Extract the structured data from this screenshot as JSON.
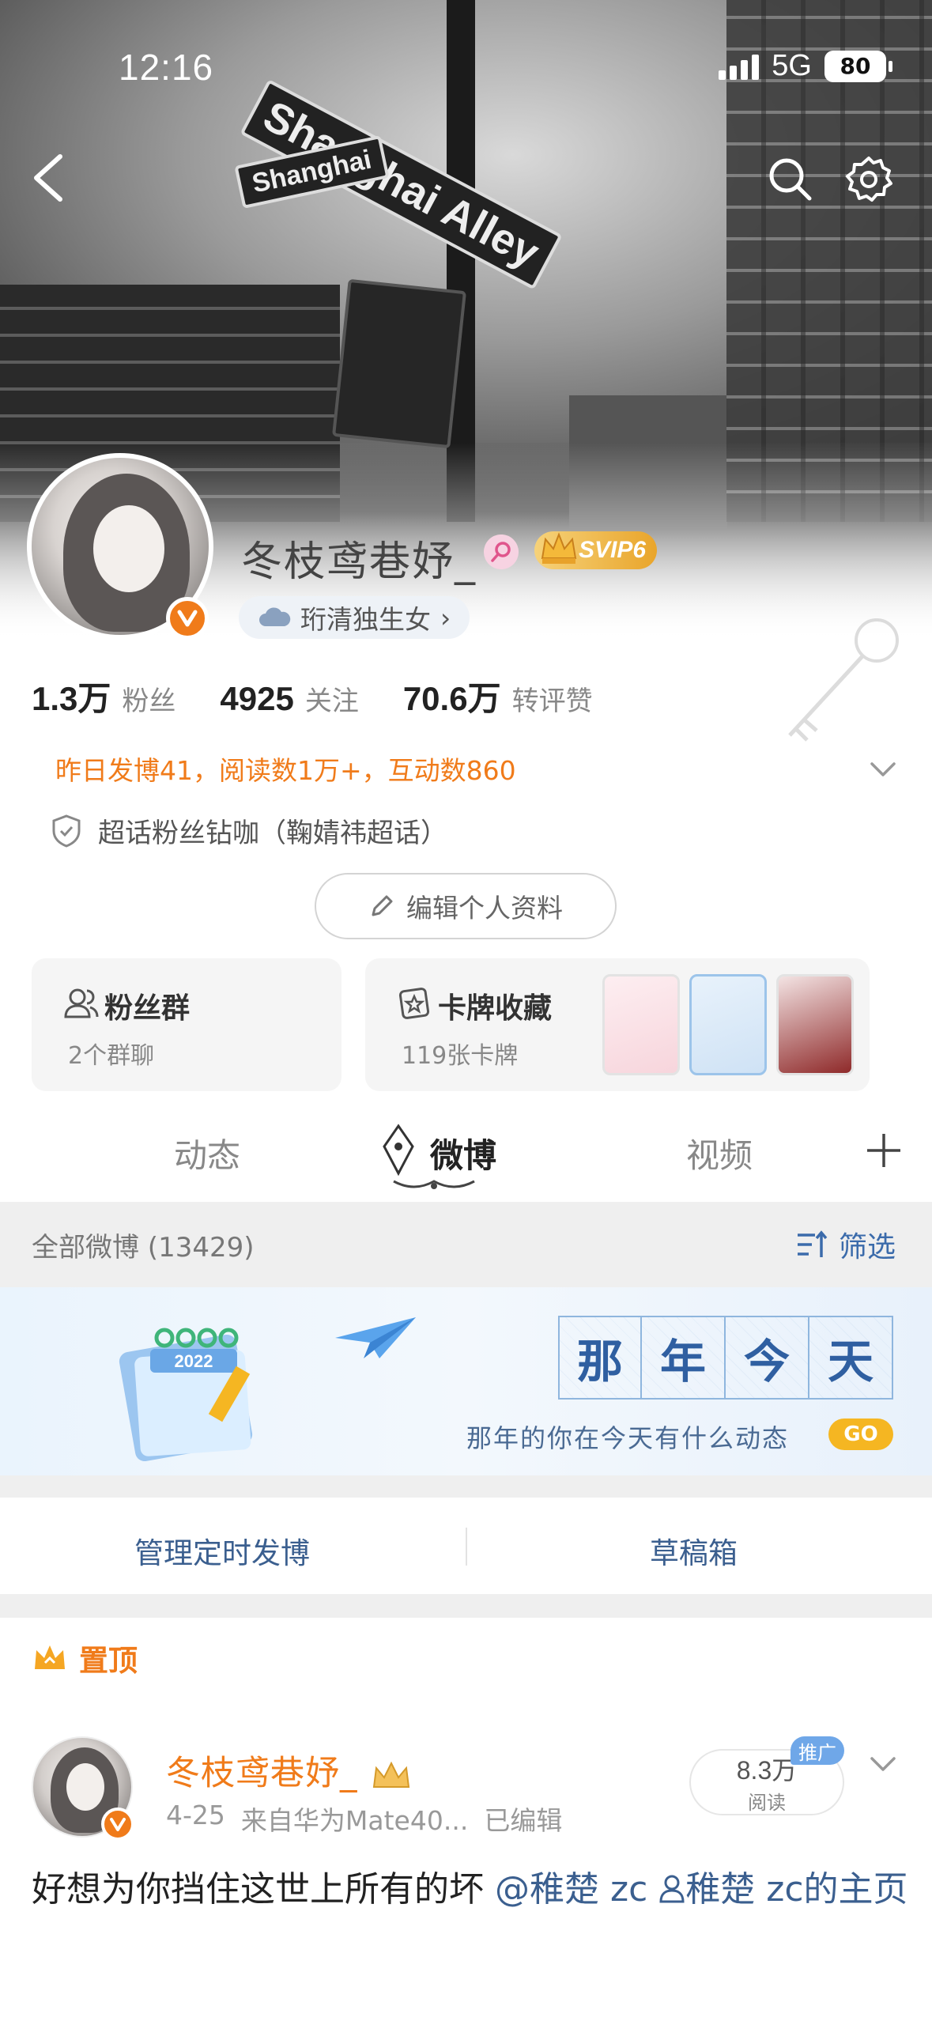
{
  "status_bar": {
    "time": "12:16",
    "network": "5G",
    "battery": "80"
  },
  "cover": {
    "sign_main": "Shanghai Alley",
    "sign_small": "Shanghai"
  },
  "profile": {
    "name": "冬枝鸢巷妤_",
    "vip": "SVIP6",
    "region": "珩清独生女",
    "region_chevron": "›",
    "stats": [
      {
        "value": "1.3万",
        "label": "粉丝"
      },
      {
        "value": "4925",
        "label": "关注"
      },
      {
        "value": "70.6万",
        "label": "转评赞"
      }
    ],
    "summary": "昨日发博41，阅读数1万+，互动数860",
    "supertopic": "超话粉丝钻咖（鞠婧祎超话）",
    "edit_button": "编辑个人资料"
  },
  "cards": {
    "fans_group": {
      "title": "粉丝群",
      "subtitle": "2个群聊"
    },
    "card_collection": {
      "title": "卡牌收藏",
      "subtitle": "119张卡牌"
    }
  },
  "tabs": [
    {
      "label": "动态",
      "active": false
    },
    {
      "label": "微博",
      "active": true
    },
    {
      "label": "视频",
      "active": false
    }
  ],
  "filter_bar": {
    "all_label": "全部微博 (13429)",
    "filter_label": "筛选"
  },
  "banner": {
    "title_chars": [
      "那",
      "年",
      "今",
      "天"
    ],
    "calendar_year": "2022",
    "subtitle": "那年的你在今天有什么动态",
    "go": "GO"
  },
  "actions": {
    "scheduled": "管理定时发博",
    "drafts": "草稿箱"
  },
  "pinned_label": "置顶",
  "post": {
    "author": "冬枝鸢巷妤_",
    "date": "4-25",
    "source": "来自华为Mate40...",
    "edited": "已编辑",
    "read_count": "8.3万",
    "read_label": "阅读",
    "promo": "推广",
    "text_before": "好想为你挡住这世上所有的坏 ",
    "mention": "@稚楚 zc",
    "link_text": "稚楚 zc的主页"
  },
  "colors": {
    "accent_orange": "#f07b1a",
    "link_blue": "#3b5f8f",
    "filter_blue": "#3b6bab",
    "section_gray": "#efefef"
  },
  "icons": {
    "back": "chevron-left-icon",
    "search": "search-icon",
    "settings": "gear-icon",
    "verified": "verified-v-icon",
    "shield": "shield-icon",
    "pencil": "pencil-icon",
    "group": "group-icon",
    "card": "card-star-icon",
    "plus": "plus-icon",
    "filter": "filter-sort-icon",
    "crown": "crown-icon",
    "chevron_down": "chevron-down-icon"
  }
}
